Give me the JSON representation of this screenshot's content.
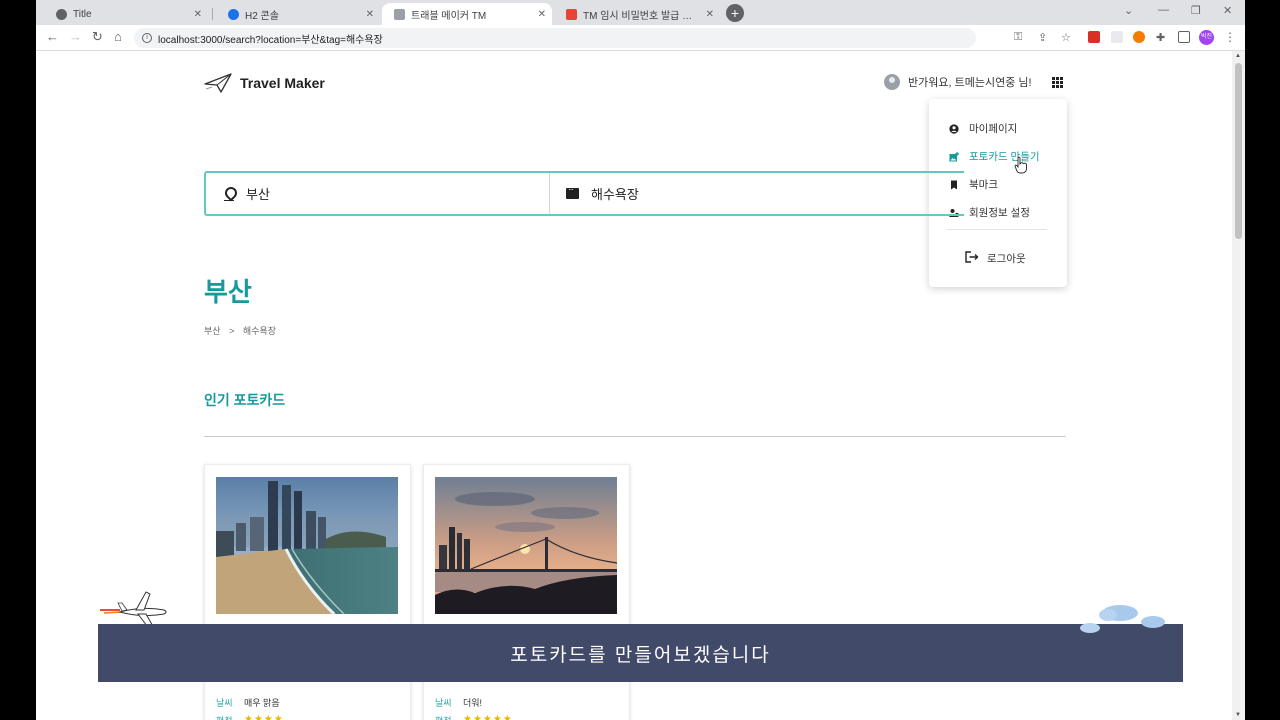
{
  "browser": {
    "tabs": [
      {
        "title": "Title",
        "favicon_color": "#5f6368",
        "active": false
      },
      {
        "title": "H2 콘솔",
        "favicon_color": "#1a73e8",
        "active": false
      },
      {
        "title": "트래블 메이커 TM",
        "favicon_color": "#9aa0a6",
        "active": true
      },
      {
        "title": "TM 임시 비밀번호 발급 메일입니다",
        "favicon_color": "#ea4335",
        "active": false
      }
    ],
    "url": "localhost:3000/search?location=부산&tag=해수욕장",
    "profile_initials": "박진",
    "close_glyph": "✕",
    "new_tab_glyph": "+"
  },
  "header": {
    "brand": "Travel Maker",
    "greeting": "반가워요, 트메는시연중 님!"
  },
  "user_menu": {
    "items": [
      {
        "label": "마이페이지",
        "icon": "person-circle-icon"
      },
      {
        "label": "포토카드 만들기",
        "icon": "photo-add-icon"
      },
      {
        "label": "북마크",
        "icon": "bookmark-icon"
      },
      {
        "label": "회원정보 설정",
        "icon": "person-gear-icon"
      }
    ],
    "logout": "로그아웃",
    "hover_index": 1
  },
  "search": {
    "location": "부산",
    "tag": "해수욕장"
  },
  "result": {
    "title": "부산",
    "breadcrumb": [
      "부산",
      ">",
      "해수욕장"
    ],
    "section_title": "인기 포토카드"
  },
  "cards": [
    {
      "weather_label": "날씨",
      "weather": "매우 맑음",
      "rating_label": "평점",
      "rating": 4,
      "stars": "★★★★"
    },
    {
      "weather_label": "날씨",
      "weather": "더워!",
      "rating_label": "평점",
      "rating": 5,
      "stars": "★★★★★"
    }
  ],
  "overlay": {
    "caption": "포토카드를 만들어보겠습니다"
  },
  "colors": {
    "accent": "#159a9c",
    "search_border": "#63c8c4",
    "caption_bg": "#424a6a"
  }
}
